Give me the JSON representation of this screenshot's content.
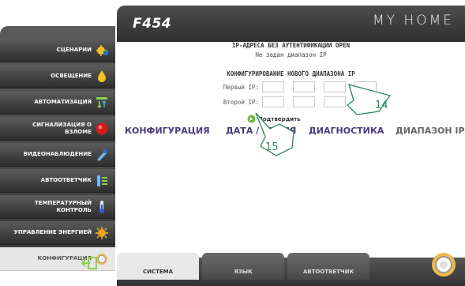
{
  "header": {
    "model": "F454",
    "brand": "MY HOME"
  },
  "sidebar": {
    "items": [
      {
        "label": "СЦЕНАРИИ",
        "icon": "scenarios-icon"
      },
      {
        "label": "ОСВЕЩЕНИЕ",
        "icon": "lightbulb-icon"
      },
      {
        "label": "АВТОМАТИЗАЦИЯ",
        "icon": "automation-icon"
      },
      {
        "label": "СИГНАЛИЗАЦИЯ О ВЗЛОМЕ",
        "icon": "alarm-icon"
      },
      {
        "label": "ВИДЕОНАБЛЮДЕНИЕ",
        "icon": "camera-icon"
      },
      {
        "label": "АВТООТВЕТЧИК",
        "icon": "answering-machine-icon"
      },
      {
        "label": "ТЕМПЕРАТУРНЫЙ КОНТРОЛЬ",
        "icon": "thermometer-icon"
      },
      {
        "label": "УПРАВЛЕНИЕ ЭНЕРГИЕЙ",
        "icon": "energy-icon"
      },
      {
        "label": "КОНФИГУРАЦИЯ",
        "icon": "gear-icon"
      }
    ],
    "active_index": 8
  },
  "content": {
    "title": "IP-АДРЕСА БЕЗ АУТЕНТИФИКАЦИИ OPEN",
    "subtitle": "Не задан диапазон IP",
    "section": "КОНФИГУРИРОВАНИЕ НОВОГО ДИАПАЗОНА IP",
    "first_ip_label": "Первый IP:",
    "second_ip_label": "Второй IP:",
    "confirm_label": "Подтвердить",
    "callout_14": "14",
    "callout_15": "15"
  },
  "tabs": {
    "config": "КОНФИГУРАЦИЯ",
    "datetime": "ДАТА / ВРЕМЯ",
    "diagnostics": "ДИАГНОСТИКА",
    "iprange": "ДИАПАЗОН IP"
  },
  "bottom_tabs": {
    "system": "СИСТЕМА",
    "language": "ЯЗЫК",
    "answering": "АВТООТВЕТЧИК"
  },
  "colors": {
    "accent_purple": "#4b3c7a",
    "callout_green": "#2f8a5e"
  }
}
